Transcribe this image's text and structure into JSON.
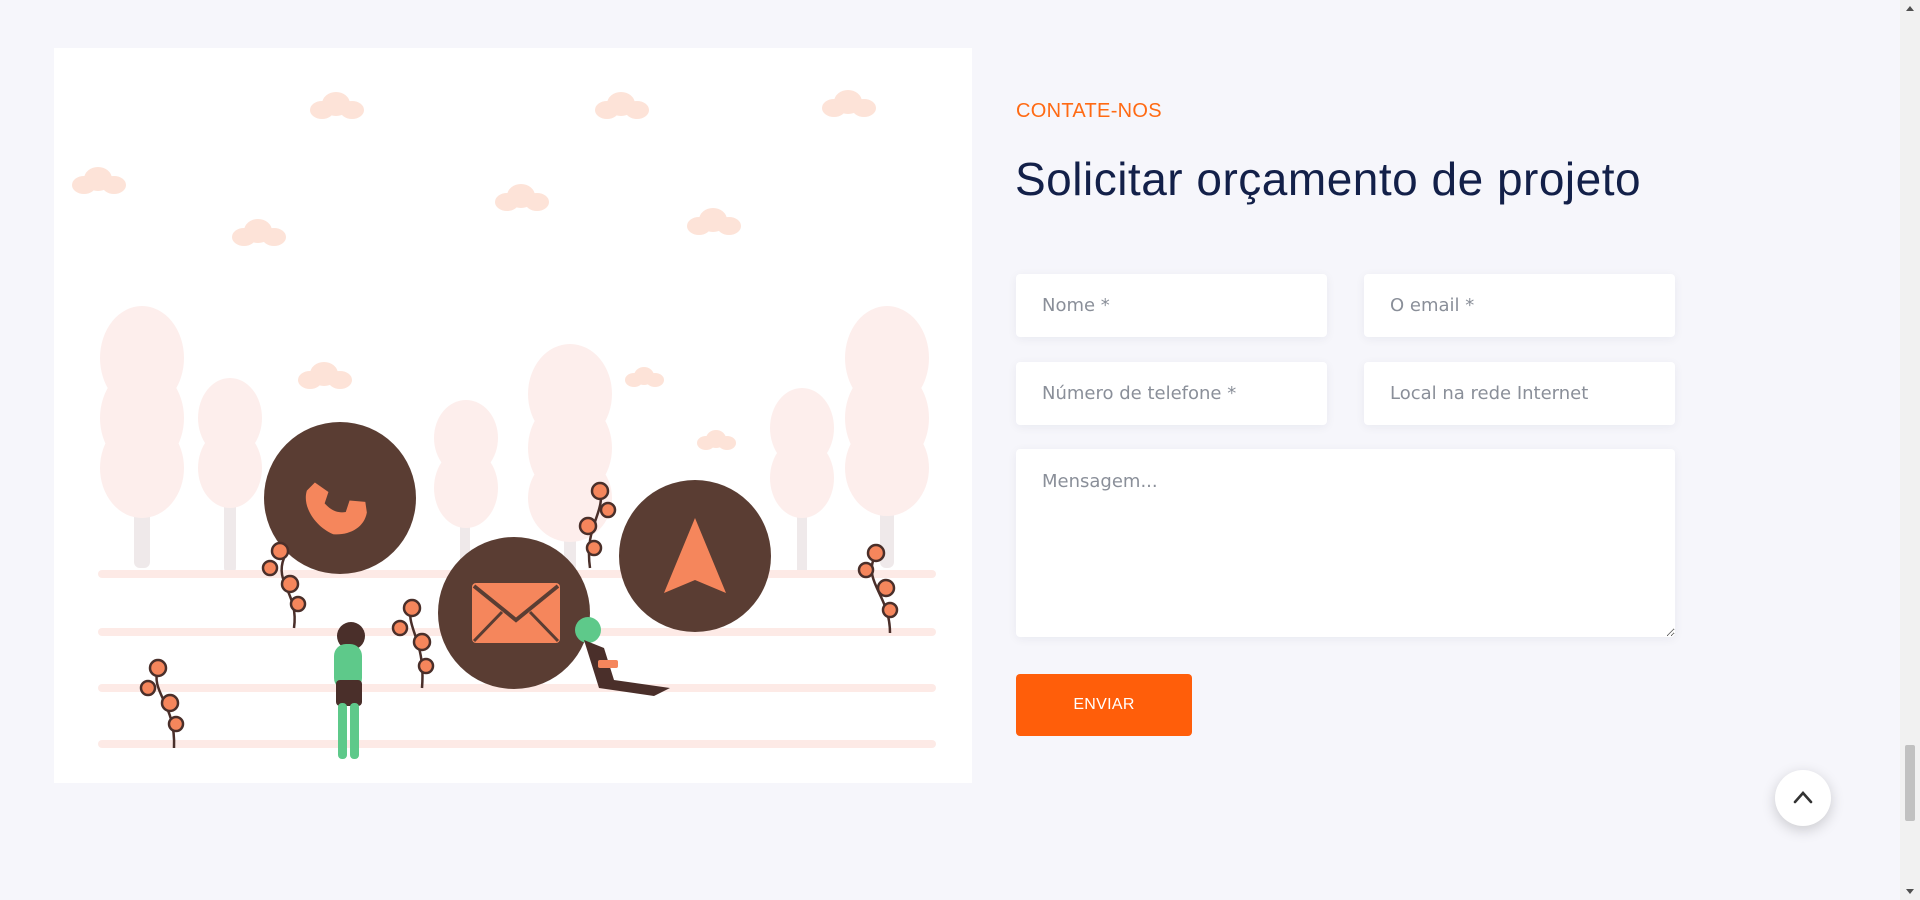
{
  "illustration": {
    "icons": [
      "phone-icon",
      "mail-icon",
      "navigation-icon"
    ],
    "colors": {
      "circle": "#5a3d33",
      "accent": "#f5865c",
      "figure": "#5ec98a",
      "cloud": "#fde3d8",
      "tree": "#fdecea"
    }
  },
  "contact": {
    "eyebrow": "CONTATE-NOS",
    "title": "Solicitar orçamento de projeto"
  },
  "form": {
    "name_placeholder": "Nome *",
    "email_placeholder": "O email *",
    "phone_placeholder": "Número de telefone *",
    "website_placeholder": "Local na rede Internet",
    "message_placeholder": "Mensagem...",
    "submit_label": "ENVIAR"
  },
  "scroll_top": {
    "icon": "chevron-up-icon"
  },
  "colors": {
    "accent": "#ff5e0a",
    "heading": "#132049",
    "background": "#f6f6fb"
  }
}
